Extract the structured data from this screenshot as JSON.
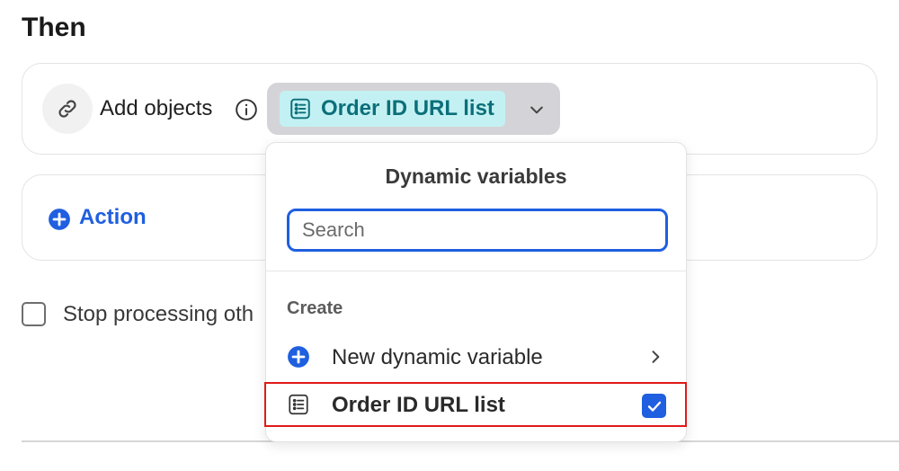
{
  "section": {
    "title": "Then"
  },
  "then_card": {
    "icon": "link-icon",
    "label": "Add objects",
    "info_icon": "info-icon",
    "selected_variable": {
      "icon": "list-icon",
      "label": "Order ID URL list",
      "chevron_icon": "chevron-down-icon"
    }
  },
  "action_card": {
    "icon": "plus-circle-icon",
    "label": "Action"
  },
  "stop_processing": {
    "checked": false,
    "label": "Stop processing oth"
  },
  "dropdown": {
    "title": "Dynamic variables",
    "search": {
      "placeholder": "Search",
      "value": ""
    },
    "group_label": "Create",
    "items": [
      {
        "icon": "plus-circle-icon",
        "label": "New dynamic variable",
        "trailing": "chevron-right-icon"
      },
      {
        "icon": "list-icon",
        "label": "Order ID URL list",
        "trailing": "checkbox-checked",
        "checked": true
      }
    ]
  },
  "colors": {
    "accent": "#1f5fe0",
    "chip_bg": "#c3f1f3",
    "chip_text": "#0c6f7a",
    "select_bg": "#d4d4d8",
    "highlight": "#e01919"
  }
}
